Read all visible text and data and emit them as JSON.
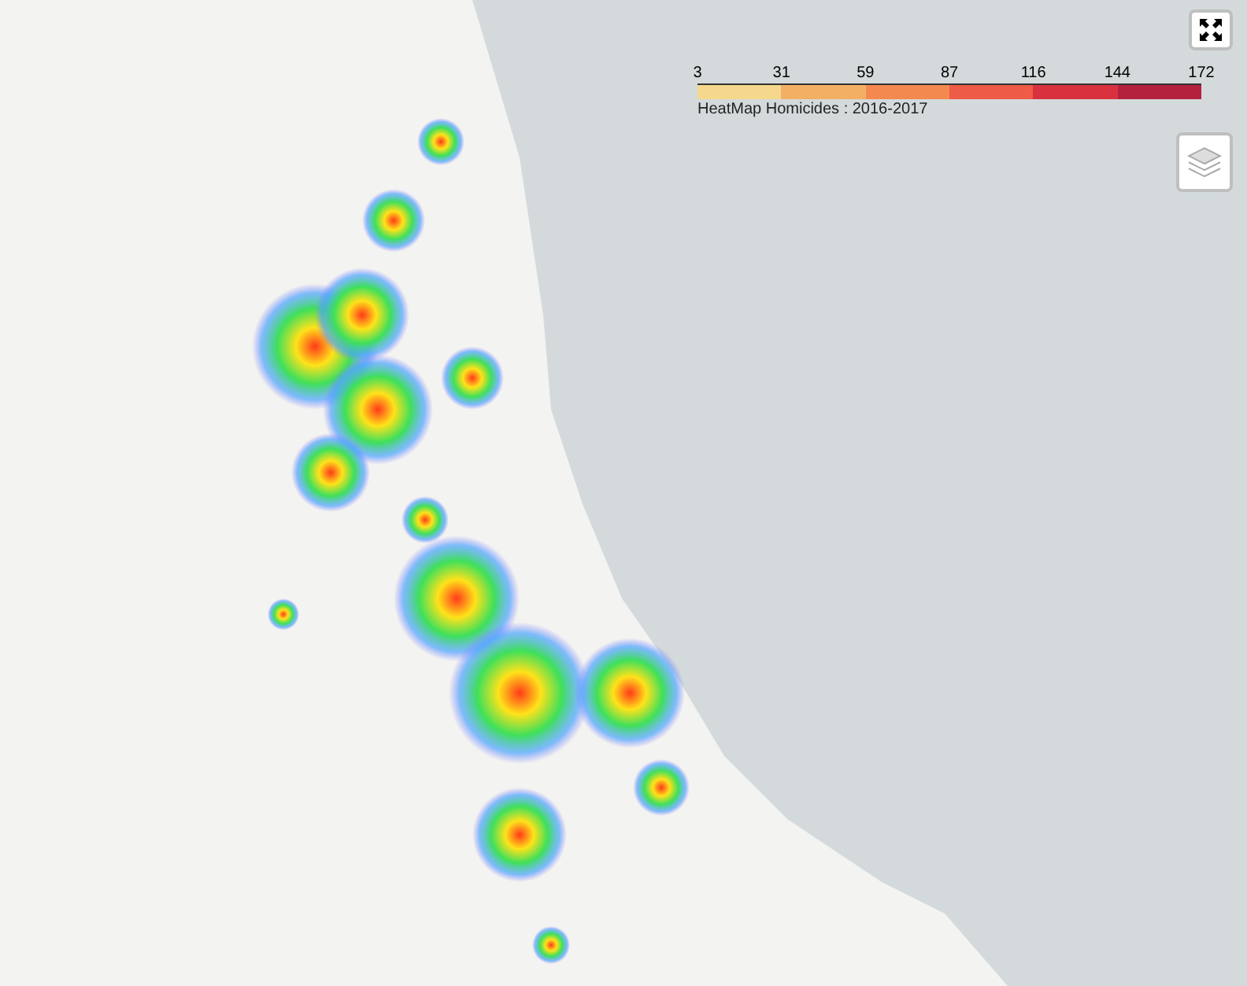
{
  "legend": {
    "ticks": [
      "3",
      "31",
      "59",
      "87",
      "116",
      "144",
      "172"
    ],
    "segments": [
      {
        "color": "#f5d88c"
      },
      {
        "color": "#f3b064"
      },
      {
        "color": "#f3894e"
      },
      {
        "color": "#ee5c47"
      },
      {
        "color": "#d9323f"
      },
      {
        "color": "#b3213d"
      }
    ],
    "caption": "HeatMap Homicides : 2016-2017"
  }
}
